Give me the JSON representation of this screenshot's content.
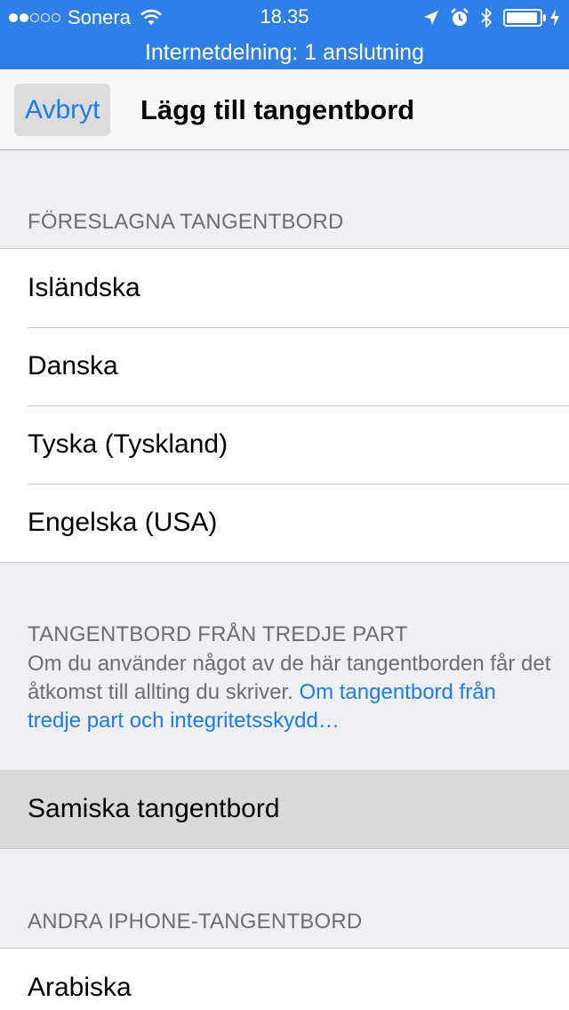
{
  "status_bar": {
    "carrier": "Sonera",
    "time": "18.35",
    "signal_bars_filled": 2,
    "signal_bars_total": 5,
    "battery_level": 0.95,
    "icons": [
      "wifi-icon",
      "location-icon",
      "alarm-icon",
      "bluetooth-icon",
      "battery-icon",
      "charging-icon"
    ]
  },
  "hotspot": {
    "text": "Internetdelning: 1 anslutning"
  },
  "navbar": {
    "cancel_label": "Avbryt",
    "title": "Lägg till tangentbord"
  },
  "suggested": {
    "header": "FÖRESLAGNA TANGENTBORD",
    "items": [
      "Isländska",
      "Danska",
      "Tyska (Tyskland)",
      "Engelska (USA)"
    ]
  },
  "third_party": {
    "header": "TANGENTBORD FRÅN TREDJE PART",
    "note_text": "Om du använder något av de här tangentborden får det åtkomst till allting du skriver. ",
    "note_link": "Om tangentbord från tredje part och integritetsskydd…",
    "items": [
      "Samiska tangentbord"
    ]
  },
  "other": {
    "header": "ANDRA IPHONE-TANGENTBORD",
    "items": [
      "Arabiska"
    ]
  },
  "colors": {
    "status_bar_bg": "#2f7fe8",
    "accent": "#1a7cf5",
    "background": "#efeff4",
    "selected_row": "#d9d9d9"
  }
}
